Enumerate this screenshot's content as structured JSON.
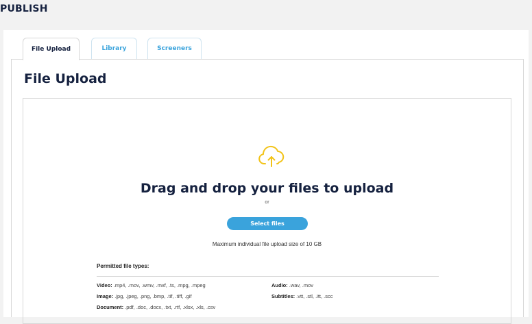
{
  "page": {
    "heading": "PUBLISH"
  },
  "tabs": [
    {
      "label": "File Upload",
      "active": true
    },
    {
      "label": "Library",
      "active": false
    },
    {
      "label": "Screeners",
      "active": false
    }
  ],
  "upload": {
    "title": "File Upload",
    "drag_text": "Drag and drop your files to upload",
    "or_text": "or",
    "select_button": "Select files",
    "max_size": "Maximum individual file upload size of 10 GB",
    "permitted_label": "Permitted file types:",
    "icon": "cloud-upload-icon",
    "file_types": {
      "video": {
        "label": "Video:",
        "values": ".mp4, .mov, .wmv, .mxf, .ts, .mpg, .mpeg"
      },
      "audio": {
        "label": "Audio:",
        "values": ".wav, .mov"
      },
      "image": {
        "label": "Image:",
        "values": ".jpg, .jpeg, .png, .bmp, .tif, .tiff, .gif"
      },
      "subtitles": {
        "label": "Subtitles:",
        "values": ".vtt, .stl, .itt, .scc"
      },
      "document": {
        "label": "Document:",
        "values": ".pdf, .doc, .docx, .txt, .rtf, .xlsx, .xls, .csv"
      }
    }
  },
  "colors": {
    "accent": "#3aa3dc",
    "navy": "#15213f",
    "icon": "#f2c318"
  }
}
